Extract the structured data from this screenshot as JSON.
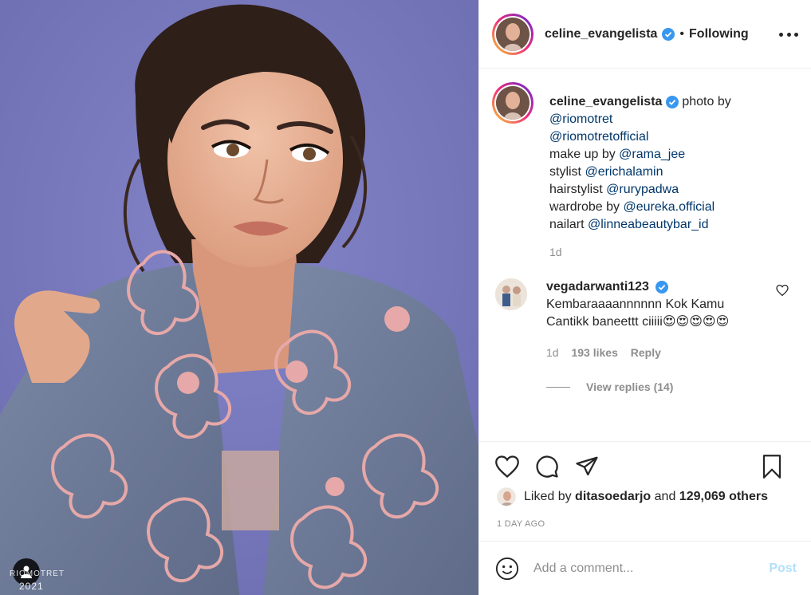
{
  "post": {
    "author": "celine_evangelista",
    "follow_state": "Following",
    "separator": "•",
    "watermark": "RIOMOTRET",
    "watermark_year": "2021"
  },
  "caption": {
    "author": "celine_evangelista",
    "intro": "photo by",
    "line1_link": "@riomotret",
    "line2_link": "@riomotretofficial",
    "line3_text": "make up by",
    "line3_link": "@rama_jee",
    "line4_text": "stylist",
    "line4_link": "@erichalamin",
    "line5_text": "hairstylist",
    "line5_link": "@rurypadwa",
    "line6_text": "wardrobe by",
    "line6_link": "@eureka.official",
    "line7_text": "nailart",
    "line7_link": "@linneabeautybar_id",
    "time": "1d"
  },
  "comment": {
    "author": "vegadarwanti123",
    "text": "Kembaraaaannnnnn Kok Kamu Cantikk baneettt ciiiii",
    "emojis": "😍😍😍😍😍",
    "time": "1d",
    "likes": "193 likes",
    "reply": "Reply",
    "view_replies": "View replies (14)"
  },
  "actions": {
    "icons": [
      "heart-icon",
      "comment-icon",
      "share-icon",
      "bookmark-icon"
    ]
  },
  "likes": {
    "prefix": "Liked by",
    "user": "ditasoedarjo",
    "middle": "and",
    "count": "129,069 others"
  },
  "date": "1 DAY AGO",
  "add_comment": {
    "placeholder": "Add a comment...",
    "post_label": "Post"
  },
  "colors": {
    "background": "#7575b8",
    "link": "#00376b",
    "verified": "#3897f0",
    "muted": "#8e8e8e",
    "post_disabled": "#b2dffc"
  }
}
